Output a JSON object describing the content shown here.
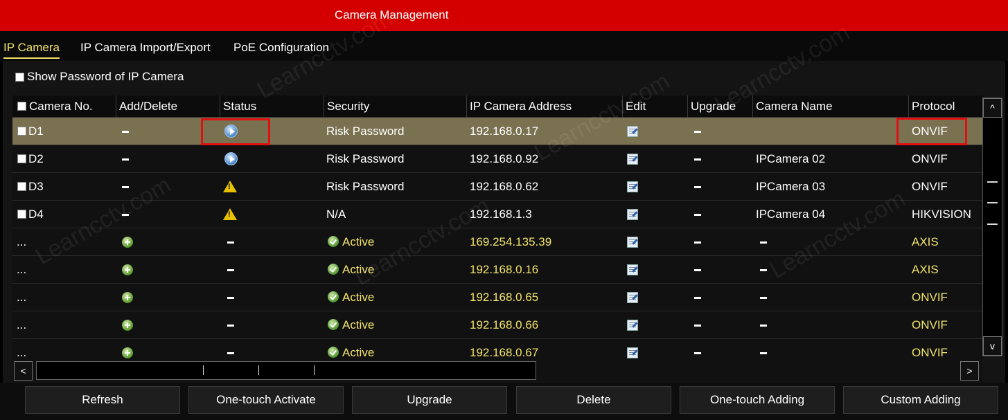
{
  "window": {
    "title": "Camera Management"
  },
  "tabs": [
    {
      "label": "IP Camera",
      "active": true
    },
    {
      "label": "IP Camera Import/Export",
      "active": false
    },
    {
      "label": "PoE Configuration",
      "active": false
    }
  ],
  "show_password": {
    "label": "Show Password of IP Camera",
    "checked": false
  },
  "table": {
    "columns": [
      "Camera No.",
      "Add/Delete",
      "Status",
      "Security",
      "IP Camera Address",
      "Edit",
      "Upgrade",
      "Camera Name",
      "Protocol"
    ],
    "rows": [
      {
        "no": "D1",
        "action": "delete",
        "status": "play",
        "security": "Risk Password",
        "ip": "192.168.0.17",
        "upgrade": "dash",
        "name": "",
        "protocol": "ONVIF",
        "selected": true,
        "added": true
      },
      {
        "no": "D2",
        "action": "delete",
        "status": "play",
        "security": "Risk Password",
        "ip": "192.168.0.92",
        "upgrade": "dash",
        "name": "IPCamera 02",
        "protocol": "ONVIF",
        "selected": false,
        "added": true
      },
      {
        "no": "D3",
        "action": "delete",
        "status": "warning",
        "security": "Risk Password",
        "ip": "192.168.0.62",
        "upgrade": "dash",
        "name": "IPCamera 03",
        "protocol": "ONVIF",
        "selected": false,
        "added": true
      },
      {
        "no": "D4",
        "action": "delete",
        "status": "warning",
        "security": "N/A",
        "ip": "192.168.1.3",
        "upgrade": "dash",
        "name": "IPCamera 04",
        "protocol": "HIKVISION",
        "selected": false,
        "added": true
      },
      {
        "no": "...",
        "action": "add",
        "status": "dash",
        "security": "Active",
        "ip": "169.254.135.39",
        "upgrade": "dash",
        "name": "dash",
        "protocol": "AXIS",
        "selected": false,
        "added": false
      },
      {
        "no": "...",
        "action": "add",
        "status": "dash",
        "security": "Active",
        "ip": "192.168.0.16",
        "upgrade": "dash",
        "name": "dash",
        "protocol": "AXIS",
        "selected": false,
        "added": false
      },
      {
        "no": "...",
        "action": "add",
        "status": "dash",
        "security": "Active",
        "ip": "192.168.0.65",
        "upgrade": "dash",
        "name": "dash",
        "protocol": "ONVIF",
        "selected": false,
        "added": false
      },
      {
        "no": "...",
        "action": "add",
        "status": "dash",
        "security": "Active",
        "ip": "192.168.0.66",
        "upgrade": "dash",
        "name": "dash",
        "protocol": "ONVIF",
        "selected": false,
        "added": false
      },
      {
        "no": "...",
        "action": "add",
        "status": "dash",
        "security": "Active",
        "ip": "192.168.0.67",
        "upgrade": "dash",
        "name": "dash",
        "protocol": "ONVIF",
        "selected": false,
        "added": false
      }
    ]
  },
  "buttons": [
    "Refresh",
    "One-touch Activate",
    "Upgrade",
    "Delete",
    "One-touch Adding",
    "Custom Adding"
  ],
  "scroll": {
    "up": "^",
    "down": "v",
    "left": "<",
    "right": ">"
  },
  "watermark": "Learncctv.com",
  "colors": {
    "title_bar": "#d40000",
    "highlight": "#e01010",
    "selected_row": "#7a7151",
    "new_device_text": "#f2e36a"
  }
}
